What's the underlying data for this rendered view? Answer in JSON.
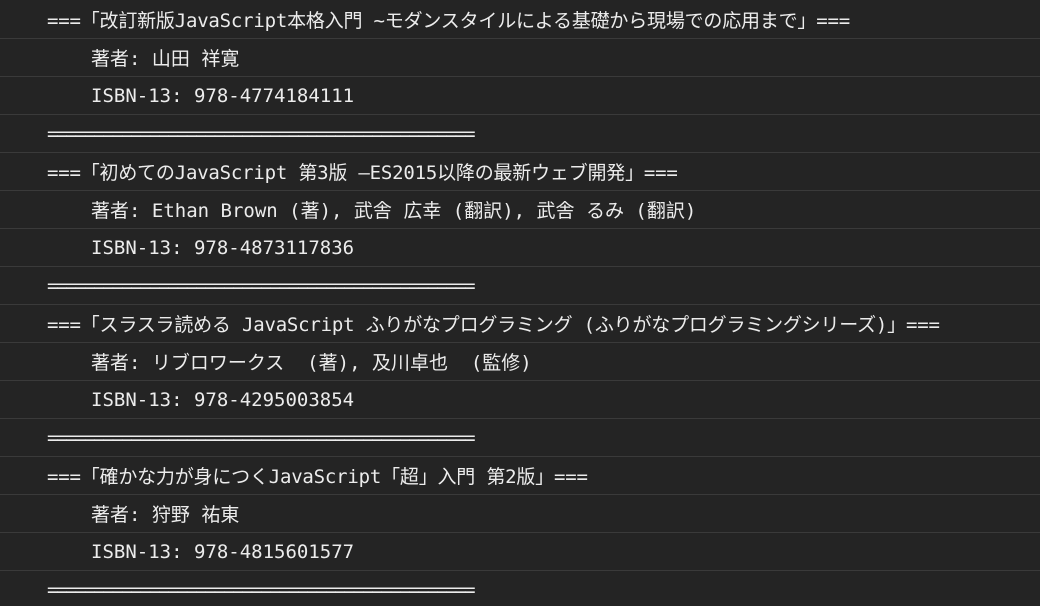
{
  "console": {
    "lines": [
      {
        "text": "===「改訂新版JavaScript本格入門 ~モダンスタイルによる基礎から現場での応用まで」==="
      },
      {
        "text": "著者: 山田 祥寛"
      },
      {
        "text": "ISBN-13: 978-4774184111"
      },
      {
        "text": "=============================================="
      },
      {
        "text": "===「初めてのJavaScript 第3版 —ES2015以降の最新ウェブ開発」==="
      },
      {
        "text": "著者: Ethan Brown (著), 武舎 広幸 (翻訳), 武舎 るみ (翻訳)"
      },
      {
        "text": "ISBN-13: 978-4873117836"
      },
      {
        "text": "=============================================="
      },
      {
        "text": "===「スラスラ読める JavaScript ふりがなプログラミング (ふりがなプログラミングシリーズ)」==="
      },
      {
        "text": "著者: リブロワークス  (著), 及川卓也  (監修)"
      },
      {
        "text": "ISBN-13: 978-4295003854"
      },
      {
        "text": "=============================================="
      },
      {
        "text": "===「確かな力が身につくJavaScript「超」入門 第2版」==="
      },
      {
        "text": "著者: 狩野 祐東"
      },
      {
        "text": "ISBN-13: 978-4815601577"
      },
      {
        "text": "=============================================="
      }
    ]
  }
}
